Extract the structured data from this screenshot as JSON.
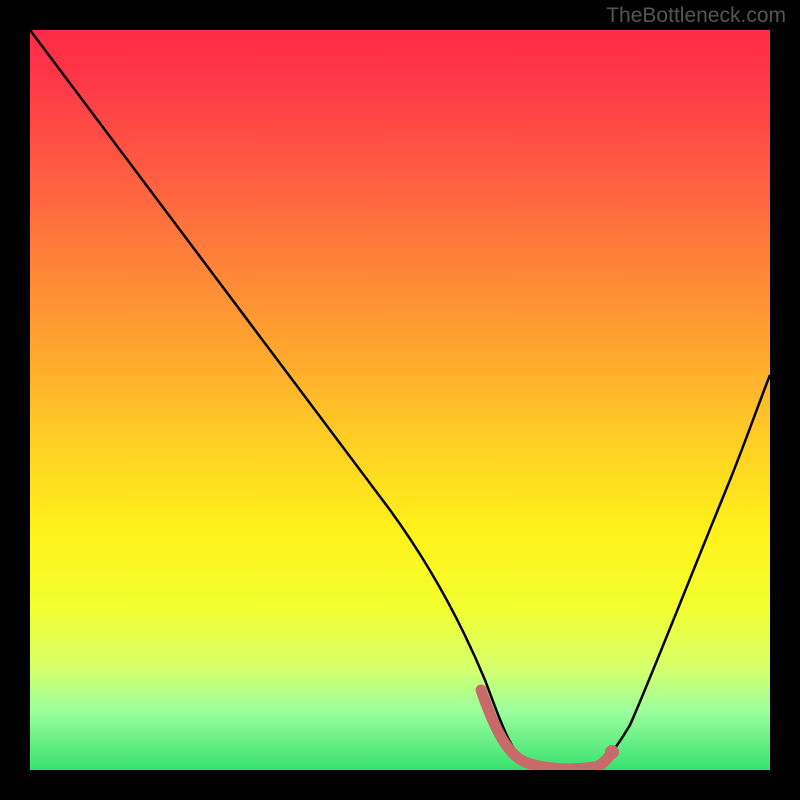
{
  "watermark": "TheBottleneck.com",
  "chart_data": {
    "type": "line",
    "title": "",
    "xlabel": "",
    "ylabel": "",
    "xlim": [
      0,
      100
    ],
    "ylim": [
      0,
      100
    ],
    "series": [
      {
        "name": "curve",
        "x": [
          0,
          5,
          10,
          15,
          20,
          25,
          30,
          35,
          40,
          45,
          50,
          55,
          60,
          63,
          66,
          70,
          74,
          77,
          80,
          85,
          90,
          95,
          100
        ],
        "y": [
          100,
          93,
          85,
          77,
          69,
          61,
          53,
          45,
          37,
          29,
          21,
          14,
          8,
          4,
          1,
          0,
          0,
          1,
          4,
          12,
          22,
          34,
          48
        ]
      }
    ],
    "highlight": {
      "x_start": 61,
      "x_end": 78,
      "color": "#c86a6a",
      "points": [
        {
          "x": 61,
          "y": 6
        },
        {
          "x": 78,
          "y": 3
        }
      ]
    },
    "gradient_stops": [
      {
        "pos": 0,
        "color": "#ff2a47"
      },
      {
        "pos": 8,
        "color": "#ff3b47"
      },
      {
        "pos": 20,
        "color": "#ff5e41"
      },
      {
        "pos": 32,
        "color": "#ff8438"
      },
      {
        "pos": 44,
        "color": "#ffa82e"
      },
      {
        "pos": 56,
        "color": "#ffd024"
      },
      {
        "pos": 68,
        "color": "#fff21a"
      },
      {
        "pos": 78,
        "color": "#f2ff30"
      },
      {
        "pos": 86,
        "color": "#d8ff6a"
      },
      {
        "pos": 92,
        "color": "#9cff9c"
      },
      {
        "pos": 100,
        "color": "#38e070"
      }
    ]
  }
}
